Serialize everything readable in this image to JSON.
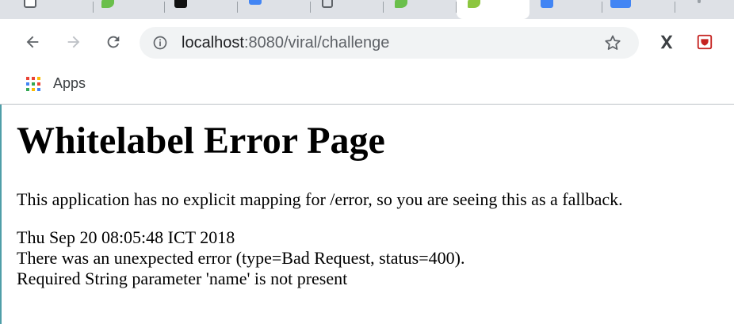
{
  "browser": {
    "url": {
      "host": "localhost",
      "path": ":8080/viral/challenge"
    },
    "bookmarks": {
      "apps_label": "Apps"
    }
  },
  "page": {
    "title": "Whitelabel Error Page",
    "message": "This application has no explicit mapping for /error, so you are seeing this as a fallback.",
    "timestamp": "Thu Sep 20 08:05:48 ICT 2018",
    "error_line": "There was an unexpected error (type=Bad Request, status=400).",
    "detail_line": "Required String parameter 'name' is not present"
  },
  "colors": {
    "chrome_bg": "#dee1e6",
    "omnibox_bg": "#f1f3f4",
    "icon": "#5f6368",
    "extension_red": "#c5221f",
    "page_text": "#000000"
  }
}
